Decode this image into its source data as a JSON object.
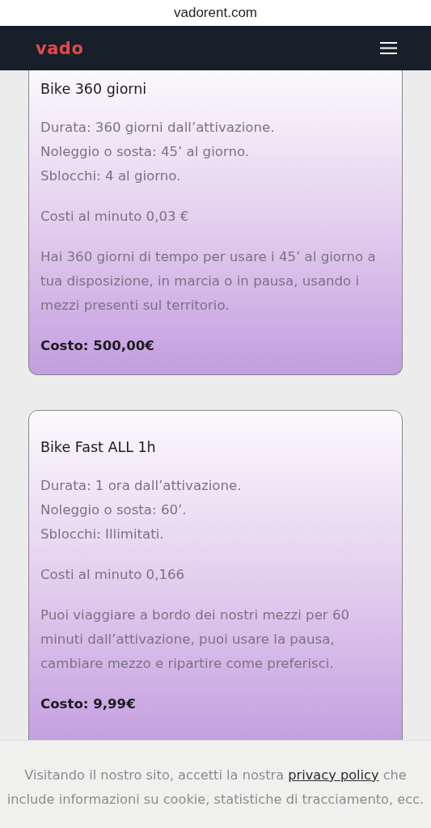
{
  "browser": {
    "address": "vadorent.com"
  },
  "header": {
    "logo": "vado"
  },
  "cards": [
    {
      "title": "Bike 360 giorni",
      "details": [
        "Durata: 360 giorni dall’attivazione.",
        "Noleggio o sosta: 45’ al giorno.",
        "Sblocchi: 4 al giorno."
      ],
      "rate": "Costi al minuto 0,03 €",
      "description": "Hai 360 giorni di  tempo per usare i 45’ al giorno a tua disposizione, in marcia o in pausa, usando i mezzi presenti sul territorio.",
      "price": "Costo: 500,00€"
    },
    {
      "title": "Bike Fast ALL 1h",
      "details": [
        "Durata: 1 ora dall’attivazione.",
        "Noleggio o sosta: 60’.",
        "Sblocchi: Illimitati."
      ],
      "rate": "Costi al minuto 0,166",
      "description": "Puoi viaggiare a bordo dei nostri mezzi per 60 minuti dall’attivazione, puoi usare la pausa, cambiare mezzo e ripartire come preferisci.",
      "price": "Costo: 9,99€"
    }
  ],
  "cookie_banner": {
    "text_before": "Visitando il nostro sito, accetti la nostra",
    "link": "privacy policy",
    "text_after": "che include informazioni su cookie, statistiche di tracciamento, ecc."
  }
}
